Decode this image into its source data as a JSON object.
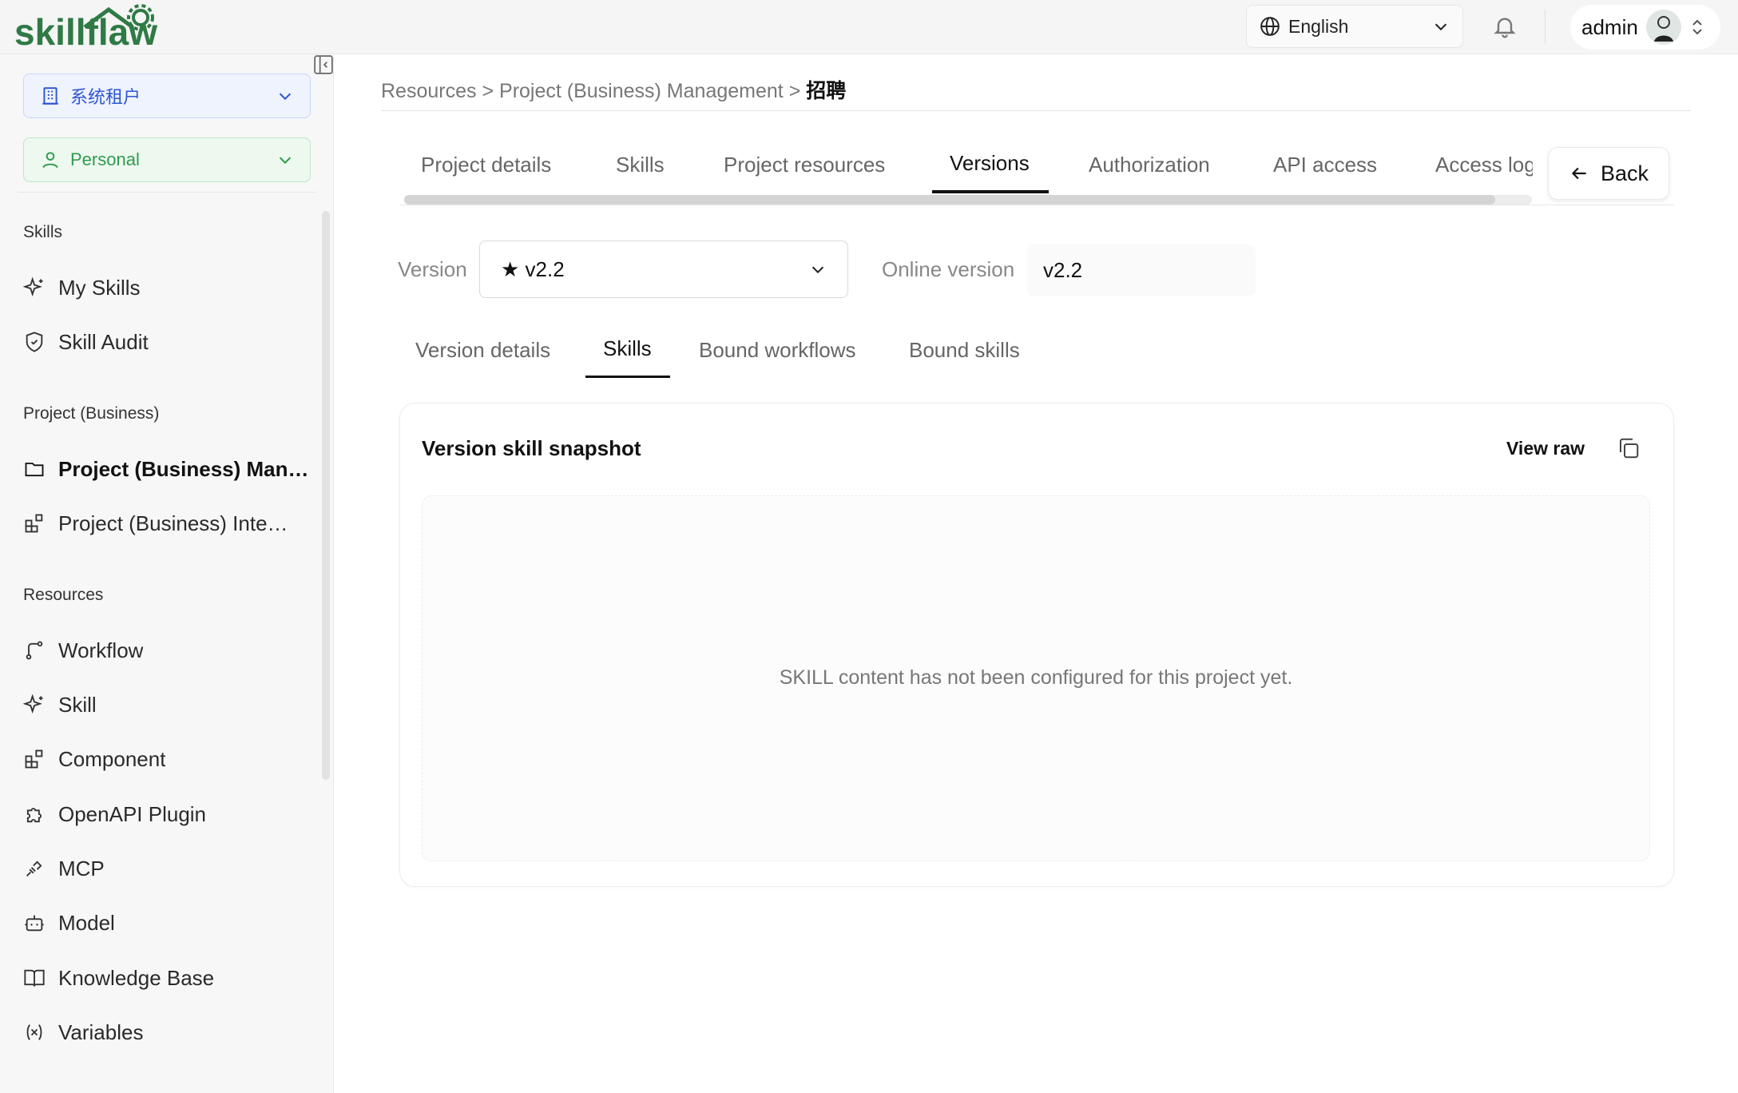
{
  "header": {
    "logo_text": "skillflaw",
    "language": "English",
    "user": "admin"
  },
  "sidebar": {
    "tenant": "系统租户",
    "workspace": "Personal",
    "groups": [
      {
        "title": "Skills",
        "items": [
          {
            "label": "My Skills",
            "icon": "sparkle-icon"
          },
          {
            "label": "Skill Audit",
            "icon": "shield-icon"
          }
        ]
      },
      {
        "title": "Project (Business)",
        "items": [
          {
            "label": "Project (Business) Man…",
            "icon": "folder-icon",
            "active": true
          },
          {
            "label": "Project (Business) Inte…",
            "icon": "blocks-icon"
          }
        ]
      },
      {
        "title": "Resources",
        "items": [
          {
            "label": "Workflow",
            "icon": "workflow-icon"
          },
          {
            "label": "Skill",
            "icon": "sparkle-icon"
          },
          {
            "label": "Component",
            "icon": "blocks-icon"
          },
          {
            "label": "OpenAPI Plugin",
            "icon": "puzzle-icon"
          },
          {
            "label": "MCP",
            "icon": "plug-icon"
          },
          {
            "label": "Model",
            "icon": "bot-icon"
          },
          {
            "label": "Knowledge Base",
            "icon": "book-icon"
          },
          {
            "label": "Variables",
            "icon": "variable-icon"
          }
        ]
      }
    ]
  },
  "breadcrumb": {
    "items": [
      "Resources",
      "Project (Business) Management"
    ],
    "separator": ">",
    "current": "招聘"
  },
  "tabs": [
    "Project details",
    "Skills",
    "Project resources",
    "Versions",
    "Authorization",
    "API access",
    "Access log"
  ],
  "active_tab": "Versions",
  "back_label": "Back",
  "version": {
    "label": "Version",
    "selected": "★ v2.2",
    "online_label": "Online version",
    "online_value": "v2.2"
  },
  "subtabs": [
    "Version details",
    "Skills",
    "Bound workflows",
    "Bound skills"
  ],
  "active_subtab": "Skills",
  "snapshot": {
    "title": "Version skill snapshot",
    "view_raw": "View raw",
    "empty_message": "SKILL content has not been configured for this project yet."
  },
  "colors": {
    "tenant_accent": "#2f55d4",
    "personal_accent": "#2f9b4d",
    "logo_green": "#2f7a45"
  }
}
